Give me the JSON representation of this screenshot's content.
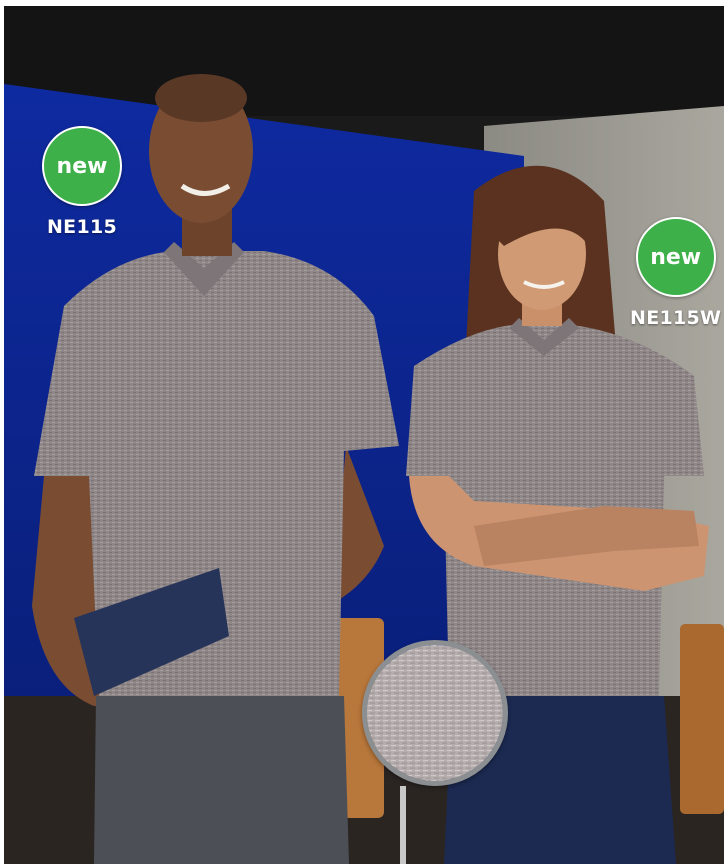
{
  "product_1": {
    "badge": "new",
    "code": "NE115"
  },
  "product_2": {
    "badge": "new",
    "code": "NE115W"
  },
  "colors": {
    "badge_green": "#3db04a",
    "wall_blue": "#0d2a9a",
    "shirt_heather": "#8f8688",
    "denim": "#1c2a52",
    "chair": "#b8773b"
  }
}
